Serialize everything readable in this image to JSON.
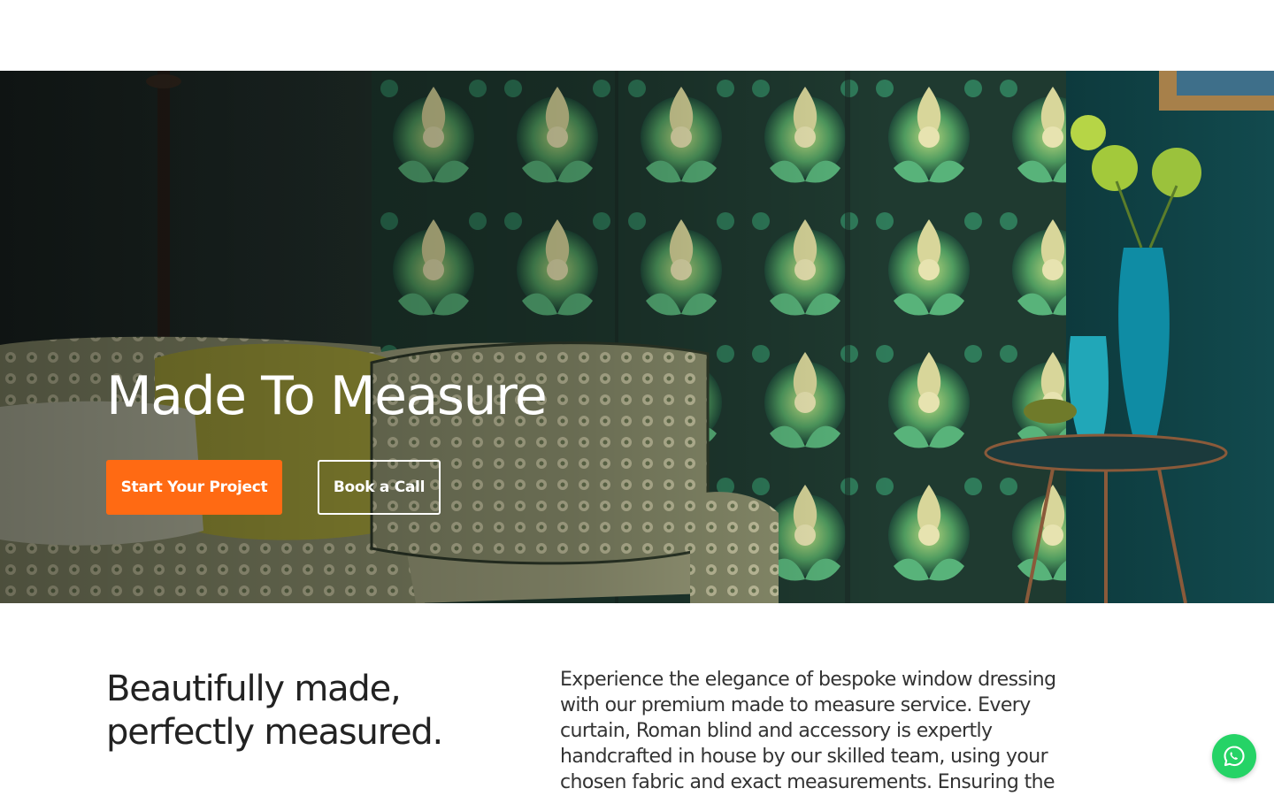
{
  "hero": {
    "title": "Made To Measure",
    "primary_button": "Start Your Project",
    "secondary_button": "Book a Call",
    "image_alt": "Living room with green floral wallpaper screen, patterned sofa and cushions, teal vases on a side table"
  },
  "intro": {
    "heading": "Beautifully made, perfectly measured.",
    "body": "Experience the elegance of bespoke window dressing with our premium made to measure service. Every curtain, Roman blind and accessory is expertly handcrafted in house by our skilled team, using your chosen fabric and exact measurements. Ensuring the"
  },
  "chat": {
    "icon": "whatsapp-icon"
  },
  "colors": {
    "accent": "#ff6a13",
    "whatsapp": "#25d366",
    "text_dark": "#222222",
    "hero_text": "#ffffff"
  }
}
